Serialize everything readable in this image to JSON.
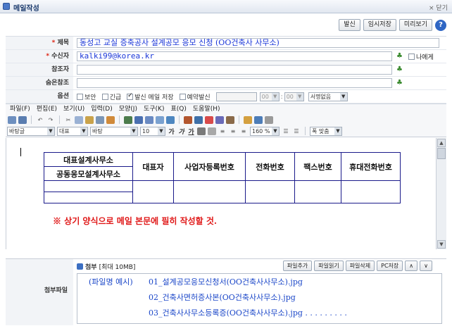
{
  "window": {
    "title": "메일작성",
    "close_label": "× 닫기"
  },
  "actions": {
    "send": "발신",
    "save_draft": "임시저장",
    "preview": "미리보기",
    "help": "?"
  },
  "header": {
    "subject_label": "제목",
    "subject_value": "동성고 교실 증축공사 설계공모 응모 신청 (OO건축사 사무소)",
    "to_label": "수신자",
    "to_value": "kalki99@korea.kr",
    "to_self_label": "나에게",
    "cc_label": "참조자",
    "bcc_label": "숨은참조",
    "options_label": "옵션",
    "options": {
      "secure": "보안",
      "urgent": "긴급",
      "save_sent": "발신 메일 저장",
      "scheduled": "예약발신",
      "hour": "00",
      "minute": "00",
      "signature": "서명없음"
    }
  },
  "menu": [
    "파일(F)",
    "편집(E)",
    "보기(U)",
    "입력(D)",
    "모양(J)",
    "도구(K)",
    "표(Q)",
    "도움말(H)"
  ],
  "format": {
    "style": "바탕글",
    "lang": "대표",
    "font": "바탕",
    "size": "10",
    "bold": "가",
    "italic": "가",
    "underline": "가",
    "line_spacing": "160 %",
    "fit": "폭 맞춤"
  },
  "body": {
    "table": {
      "col1_header_top": "대표설계사무소",
      "col1_header_bottom": "공동응모설계사무소",
      "headers": [
        "대표자",
        "사업자등록번호",
        "전화번호",
        "팩스번호",
        "휴대전화번호"
      ]
    },
    "note": "※ 상기 양식으로 메일 본문에 필히 작성할 것."
  },
  "attachment": {
    "label": "첨부파일",
    "head_title": "첨부",
    "head_limit": "[최대 10MB]",
    "buttons": {
      "add": "파일추가",
      "read": "파일읽기",
      "delete": "파일삭제",
      "pc_save": "PC저장"
    },
    "example_label": "(파일명 예시)",
    "files": [
      "01_설계공모응모신청서(OO건축사사무소).jpg",
      "02_건축사면허증사본(OO건축사사무소).jpg",
      "03_건축사사무소등록증(OO건축사사무소).jpg . . . . . . . . ."
    ]
  }
}
